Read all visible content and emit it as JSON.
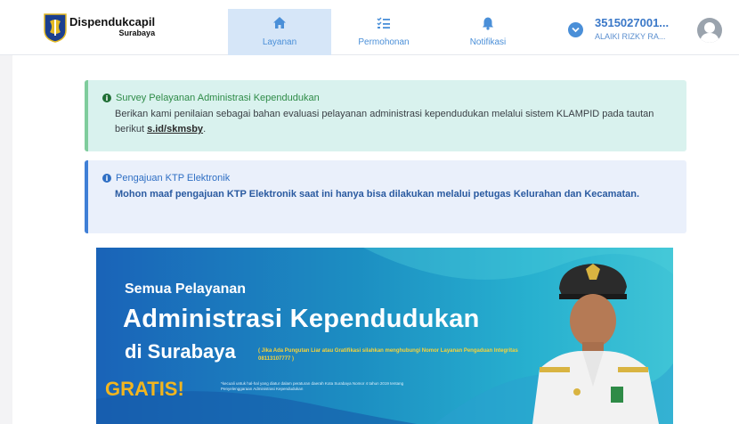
{
  "header": {
    "brand_name": "Dispendukcapil",
    "brand_sub": "Surabaya",
    "nav": [
      {
        "label": "Layanan",
        "icon": "home-icon",
        "active": true
      },
      {
        "label": "Permohonan",
        "icon": "list-icon",
        "active": false
      },
      {
        "label": "Notifikasi",
        "icon": "bell-icon",
        "active": false
      }
    ],
    "user": {
      "id": "3515027001...",
      "name": "ALAIKI RIZKY RA..."
    }
  },
  "alerts": [
    {
      "title": "Survey Pelayanan Administrasi Kependudukan",
      "body_prefix": "Berikan kami penilaian sebagai bahan evaluasi pelayanan administrasi kependudukan melalui sistem KLAMPID pada tautan berikut ",
      "link_text": "s.id/skmsby",
      "body_suffix": "."
    },
    {
      "title": "Pengajuan KTP Elektronik",
      "body": "Mohon maaf pengajuan KTP Elektronik saat ini hanya bisa dilakukan melalui petugas Kelurahan dan Kecamatan."
    }
  ],
  "banner": {
    "line1": "Semua Pelayanan",
    "line2": "Administrasi Kependudukan",
    "line3": "di Surabaya",
    "note": "( Jika Ada Pungutan Liar atau Gratifikasi silahkan menghubungi Nomor Layanan Pengaduan Integritas 08113107777 )",
    "gratis": "GRATIS!",
    "small": "*kecuali untuk hal-hal yang diatur dalam peraturan daerah Kota Surabaya Nomor 4 tahun 2019 tentang Penyelenggaraan Administrasi Kependudukan"
  },
  "colors": {
    "accent": "#4a8fd8",
    "success_bg": "#d9f2ee",
    "info_bg": "#eaf0fb",
    "banner_start": "#1a63b8",
    "gratis": "#f2b51e"
  }
}
